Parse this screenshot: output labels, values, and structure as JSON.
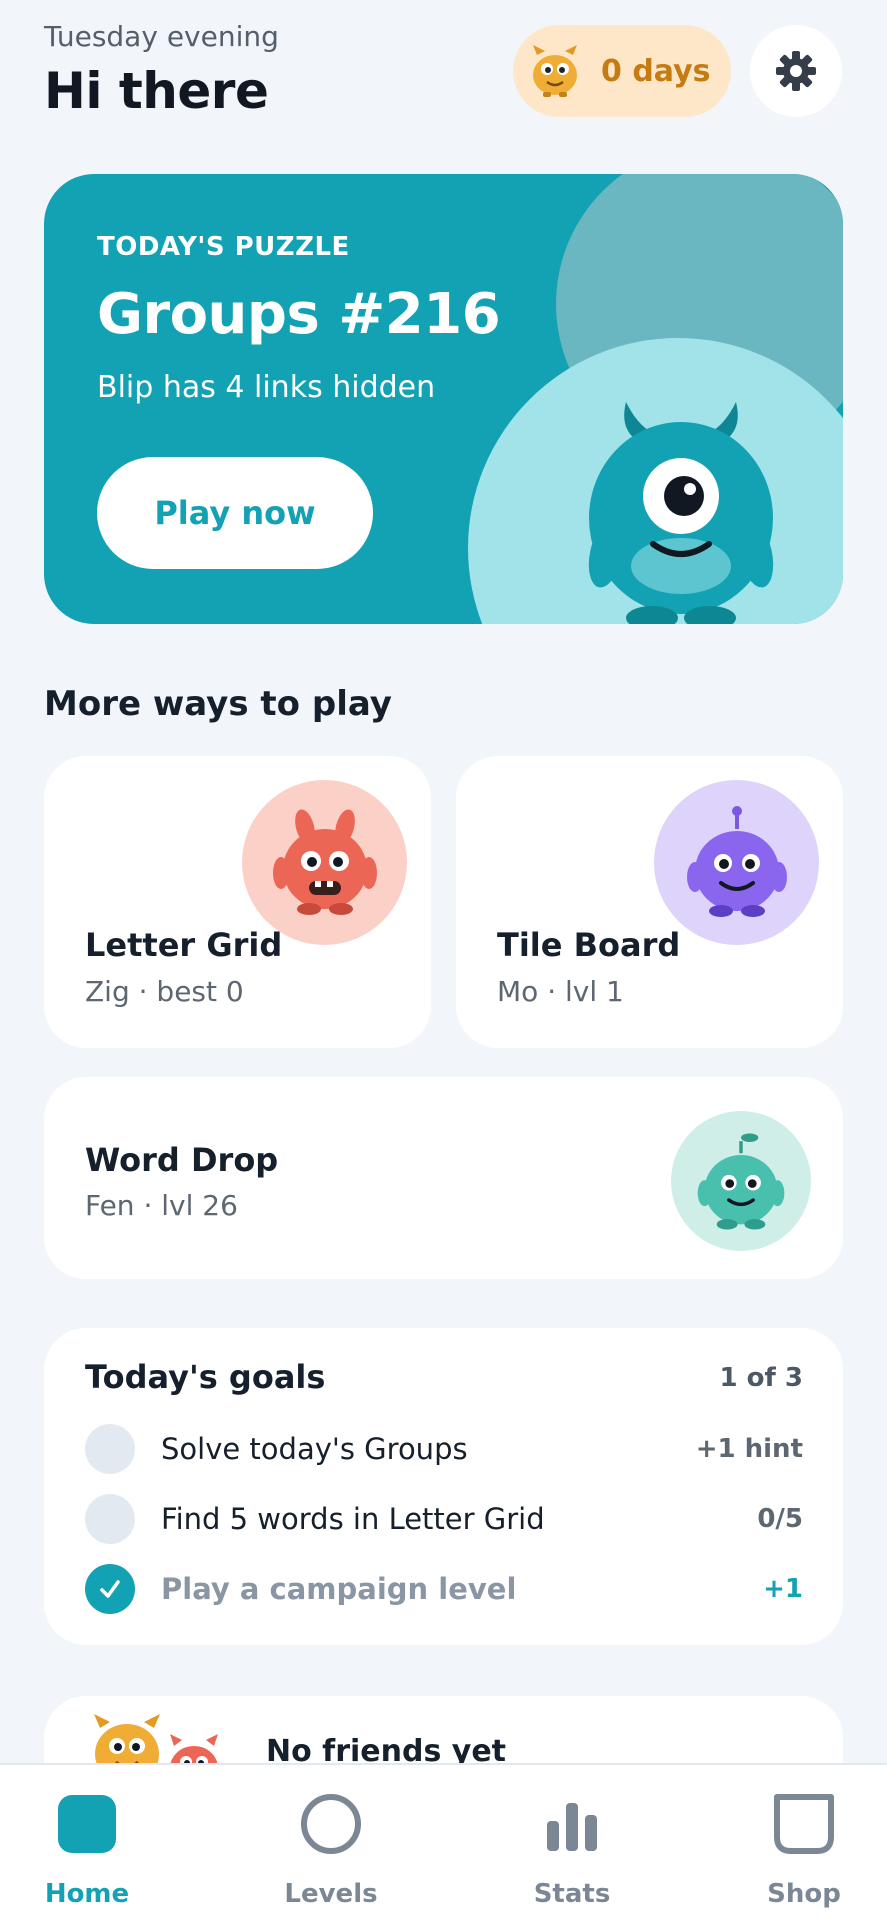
{
  "header": {
    "greeting": "Tuesday evening",
    "title": "Hi there",
    "streak_label": "0 days",
    "streak_icon": "monster-icon",
    "settings_icon": "gear-icon"
  },
  "hero": {
    "label": "TODAY'S PUZZLE",
    "title": "Groups #216",
    "subtitle": "Blip has 4 links hidden",
    "play_label": "Play now"
  },
  "section_title": "More ways to play",
  "games": [
    {
      "title": "Letter Grid",
      "subtitle": "Zig · best 0"
    },
    {
      "title": "Tile Board",
      "subtitle": "Mo · lvl 1"
    },
    {
      "title": "Word Drop",
      "subtitle": "Fen · lvl 26"
    }
  ],
  "goals": {
    "title": "Today's goals",
    "count": "1 of 3",
    "items": [
      {
        "text": "Solve today's Groups",
        "reward": "+1 hint",
        "done": false
      },
      {
        "text": "Find 5 words in Letter Grid",
        "reward": "0/5",
        "done": false
      },
      {
        "text": "Play a campaign level",
        "reward": "+1",
        "done": true
      }
    ]
  },
  "friends": {
    "text": "No friends yet"
  },
  "nav": {
    "items": [
      {
        "label": "Home",
        "icon": "home-icon",
        "active": true
      },
      {
        "label": "Levels",
        "icon": "levels-icon",
        "active": false
      },
      {
        "label": "Stats",
        "icon": "stats-icon",
        "active": false
      },
      {
        "label": "Shop",
        "icon": "shop-icon",
        "active": false
      }
    ]
  },
  "colors": {
    "accent": "#12a2b3",
    "background": "#f2f6fa",
    "streak_bg": "#fde7c8",
    "streak_text": "#c57b12"
  }
}
